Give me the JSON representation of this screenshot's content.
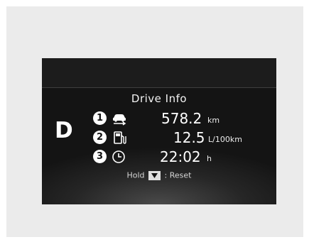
{
  "display": {
    "gear": "D",
    "title": "Drive Info",
    "rows": [
      {
        "marker": "1",
        "icon": "car-distance-icon",
        "value": "578.2",
        "unit": "km"
      },
      {
        "marker": "2",
        "icon": "fuel-pump-icon",
        "value": "12.5",
        "unit": "L/100km"
      },
      {
        "marker": "3",
        "icon": "clock-icon",
        "value": "22:02",
        "unit": "h"
      }
    ],
    "hint": {
      "prefix": "Hold",
      "key_icon": "down-arrow-key-icon",
      "suffix": ": Reset"
    }
  },
  "colors": {
    "frame_background": "#ebebeb",
    "screen_background": "#1b1b1b",
    "text": "#ffffff"
  }
}
